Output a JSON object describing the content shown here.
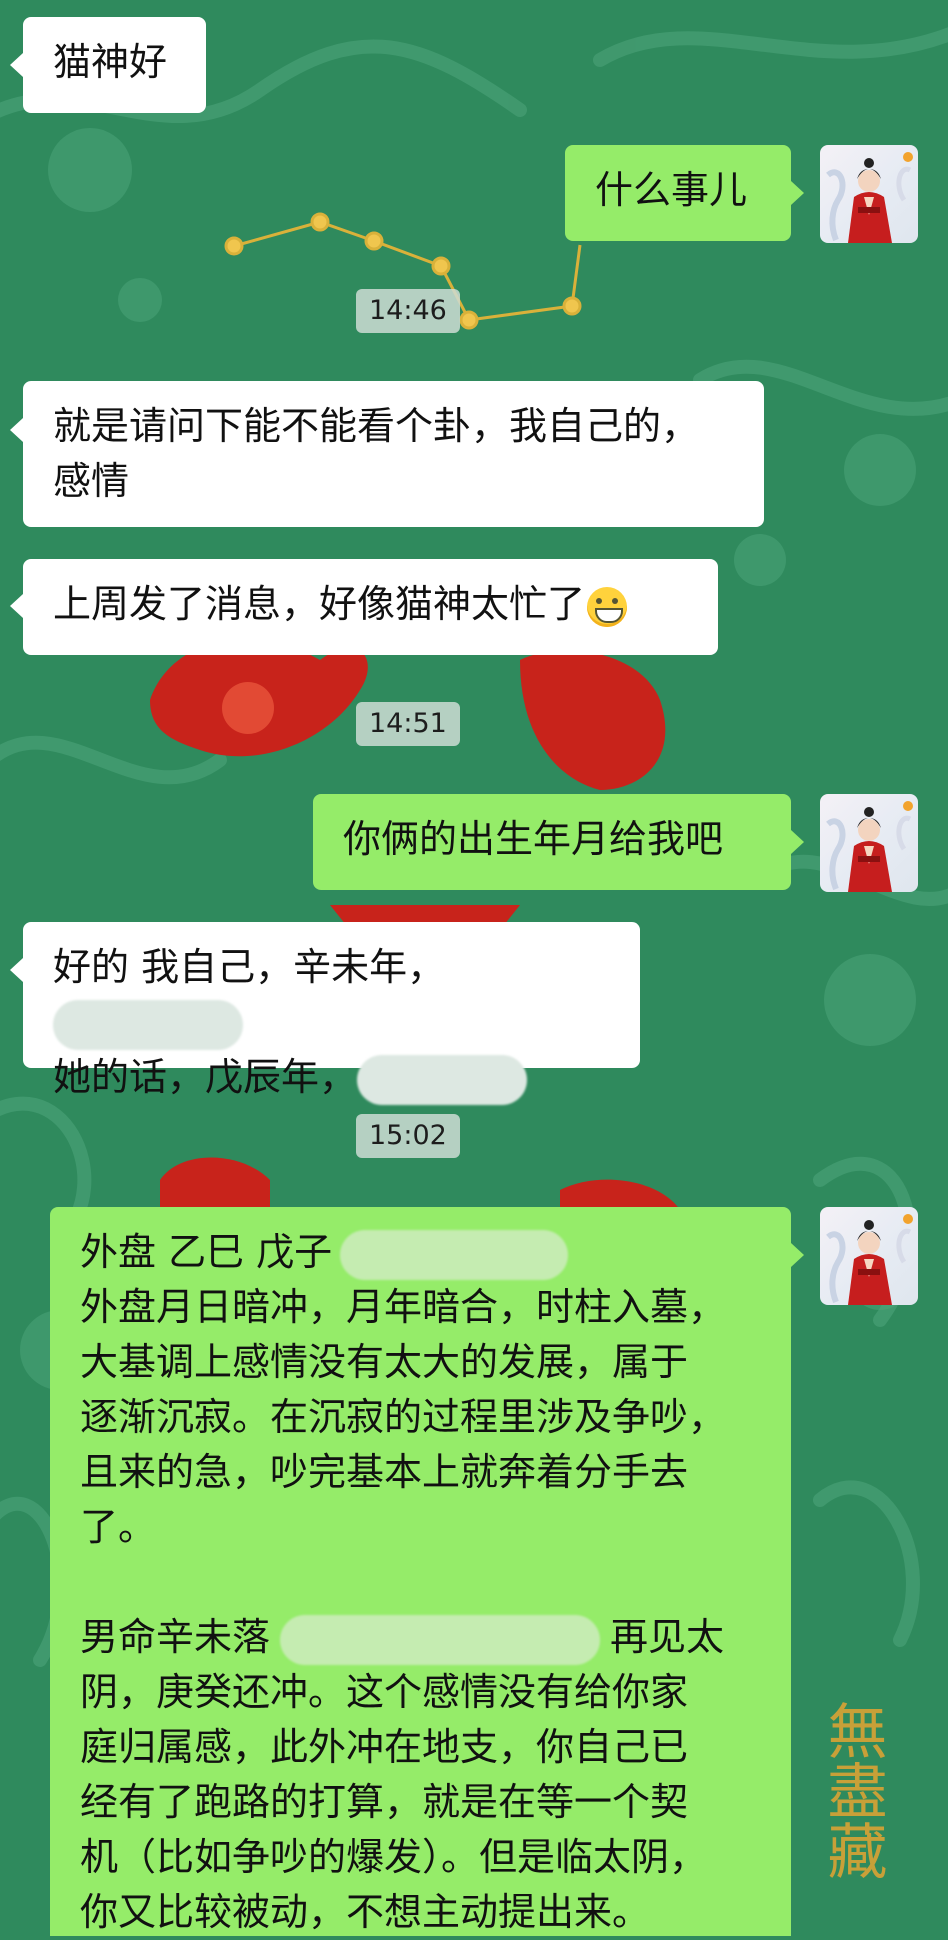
{
  "colors": {
    "background": "#2f8a5d",
    "incoming_bubble": "#ffffff",
    "outgoing_bubble": "#95ec69",
    "timestamp_bg": "#cddcd4",
    "watermark": "#d9a334"
  },
  "messages": [
    {
      "from": "other",
      "lines": [
        "猫神好"
      ]
    },
    {
      "from": "me",
      "lines": [
        "什么事儿"
      ]
    },
    {
      "timestamp": "14:46"
    },
    {
      "from": "other",
      "lines": [
        "就是请问下能不能看个卦，我自己的，",
        "感情"
      ]
    },
    {
      "from": "other",
      "lines": [
        "上周发了消息，好像猫神太忙了"
      ],
      "emoji": "grinning-face"
    },
    {
      "timestamp": "14:51"
    },
    {
      "from": "me",
      "lines": [
        "你俩的出生年月给我吧"
      ]
    },
    {
      "from": "other",
      "lines": [
        "好的 我自己，辛未年，",
        "她的话，戊辰年，"
      ]
    },
    {
      "timestamp": "15:02"
    },
    {
      "from": "me",
      "paragraph1": [
        "外盘  乙巳 戊子",
        "外盘月日暗冲，月年暗合，时柱入墓，",
        "大基调上感情没有太大的发展，属于",
        "逐渐沉寂。在沉寂的过程里涉及争吵，",
        "且来的急，吵完基本上就奔着分手去",
        "了。"
      ],
      "paragraph2": [
        "男命辛未落",
        "再见太",
        "阴，庚癸还冲。这个感情没有给你家",
        "庭归属感，此外冲在地支，你自己已",
        "经有了跑路的打算，就是在等一个契",
        "机（比如争吵的爆发）。但是临太阴，",
        "你又比较被动，不想主动提出来。"
      ]
    }
  ],
  "watermark_text": "無盡藏",
  "avatar_icon": "woman-in-red-robe-avatar"
}
